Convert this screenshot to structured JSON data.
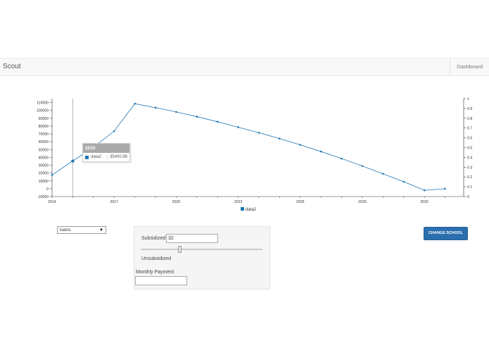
{
  "navbar": {
    "brand": "Scout",
    "dashboard_label": "Dashboard"
  },
  "chart_data": {
    "type": "line",
    "x": [
      2014,
      2015,
      2016,
      2017,
      2018,
      2019,
      2020,
      2021,
      2022,
      2023,
      2024,
      2025,
      2026,
      2027,
      2028,
      2029,
      2030,
      2031,
      2032,
      2033,
      2034
    ],
    "series": [
      {
        "name": "data2",
        "values": [
          17500,
          35400.89,
          53000,
          73500,
          108500,
          103500,
          98000,
          92000,
          85500,
          78500,
          71500,
          64000,
          56000,
          47500,
          38500,
          29000,
          19000,
          9000,
          -2000,
          0,
          0
        ]
      }
    ],
    "xticks": [
      "2014",
      "2017",
      "2020",
      "2023",
      "2026",
      "2029",
      "2032"
    ],
    "yticks": [
      "-10000",
      "0",
      "10000",
      "20000",
      "30000",
      "40000",
      "50000",
      "60000",
      "70000",
      "80000",
      "90000",
      "100000",
      "110000"
    ],
    "y2ticks": [
      "0",
      "0.1",
      "0.2",
      "0.3",
      "0.4",
      "0.5",
      "0.6",
      "0.7",
      "0.8",
      "0.9",
      "1"
    ],
    "ylim": [
      -10000,
      115000
    ],
    "y2lim": [
      0,
      1
    ],
    "xlim": [
      2014,
      2033.9
    ],
    "legend": "bottom-center",
    "color": "#1f77b4"
  },
  "tooltip": {
    "title": "2015",
    "series_name": "data2",
    "value": "35400.89"
  },
  "form": {
    "select_value": "loans",
    "subsidized_label": "Subsidized",
    "subsidized_value": "32",
    "slider_fraction": 0.32,
    "unsubsidized_label": "Unsubsidized",
    "monthly_payment_label": "Monthly Payment",
    "monthly_payment_value": ""
  },
  "actions": {
    "change_school_label": "CHANGE SCHOOL"
  }
}
